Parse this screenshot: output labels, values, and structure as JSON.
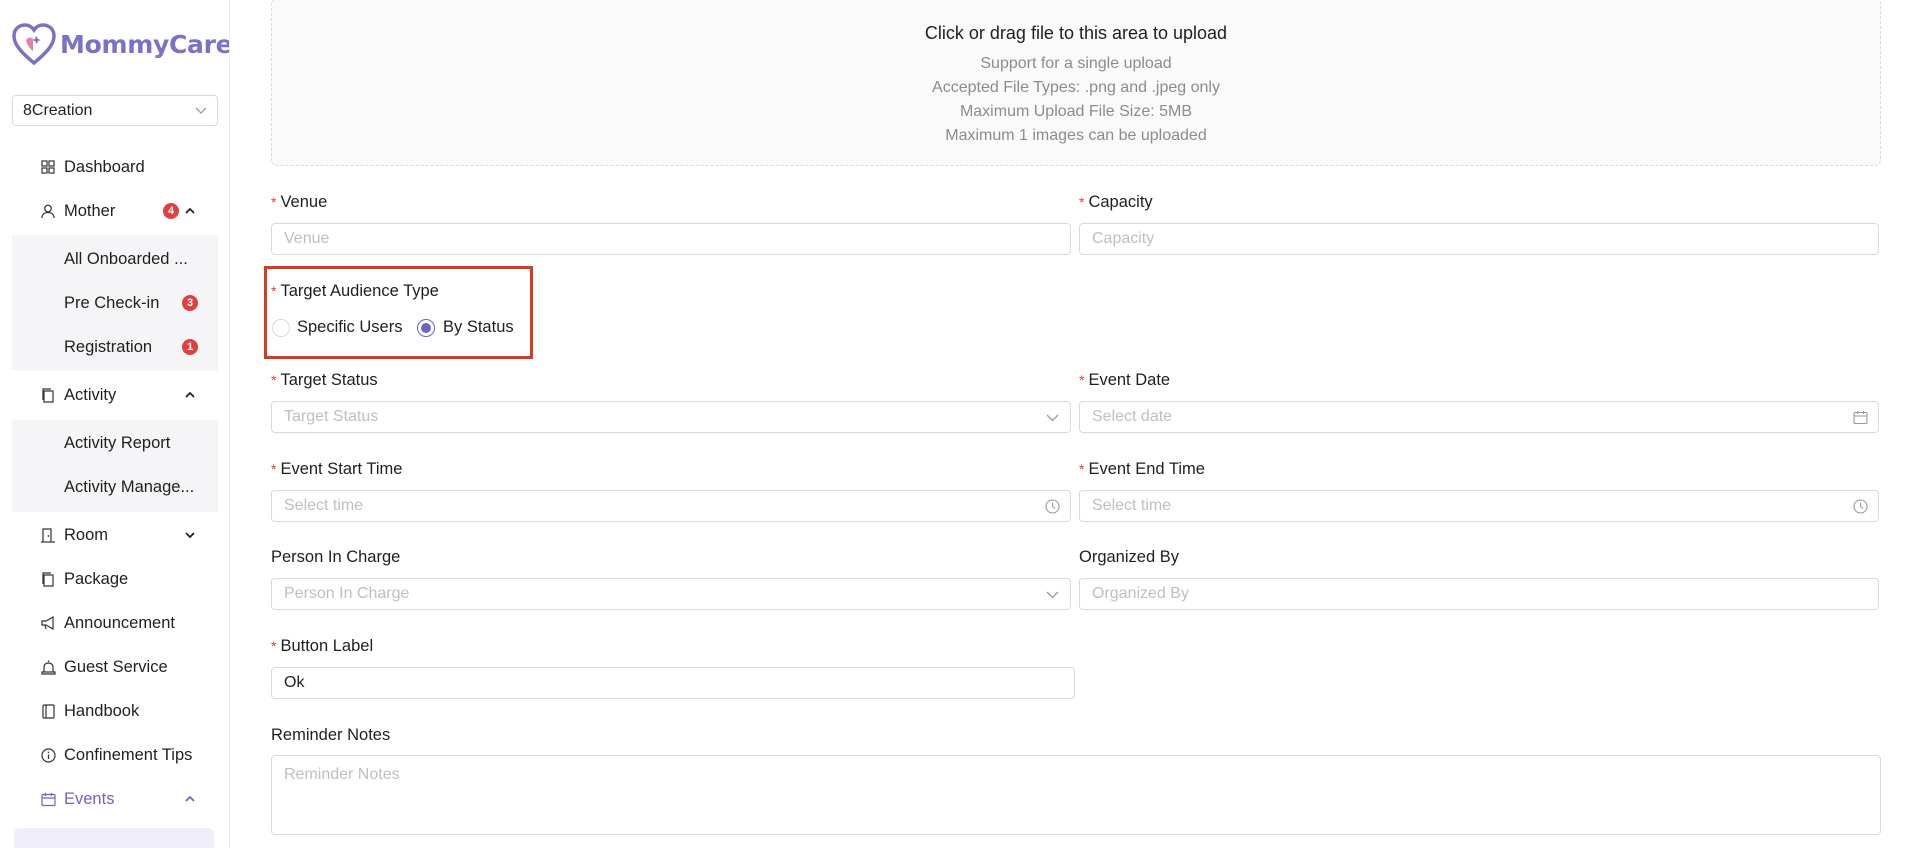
{
  "brand": {
    "name": "MommyCare",
    "plus": "+"
  },
  "company_select": {
    "value": "8Creation"
  },
  "sidebar": {
    "items": [
      {
        "label": "Dashboard"
      },
      {
        "label": "Mother",
        "badge": "4"
      },
      {
        "label": "Activity"
      },
      {
        "label": "Room"
      },
      {
        "label": "Package"
      },
      {
        "label": "Announcement"
      },
      {
        "label": "Guest Service"
      },
      {
        "label": "Handbook"
      },
      {
        "label": "Confinement Tips"
      },
      {
        "label": "Events"
      }
    ],
    "mother_sub": [
      {
        "label": "All Onboarded ..."
      },
      {
        "label": "Pre Check-in",
        "badge": "3"
      },
      {
        "label": "Registration",
        "badge": "1"
      }
    ],
    "activity_sub": [
      {
        "label": "Activity Report"
      },
      {
        "label": "Activity Manage..."
      }
    ]
  },
  "upload": {
    "title": "Click or drag file to this area to upload",
    "lines": [
      "Support for a single upload",
      "Accepted File Types: .png and .jpeg only",
      "Maximum Upload File Size: 5MB",
      "Maximum 1 images can be uploaded"
    ]
  },
  "form": {
    "venue": {
      "label": "Venue",
      "placeholder": "Venue",
      "required": "*"
    },
    "capacity": {
      "label": "Capacity",
      "placeholder": "Capacity",
      "required": "*"
    },
    "audience": {
      "label": "Target Audience Type",
      "required": "*",
      "options": [
        "Specific Users",
        "By Status"
      ],
      "selected": "By Status"
    },
    "target_status": {
      "label": "Target Status",
      "placeholder": "Target Status",
      "required": "*"
    },
    "event_date": {
      "label": "Event Date",
      "placeholder": "Select date",
      "required": "*"
    },
    "start_time": {
      "label": "Event Start Time",
      "placeholder": "Select time",
      "required": "*"
    },
    "end_time": {
      "label": "Event End Time",
      "placeholder": "Select time",
      "required": "*"
    },
    "person_in_charge": {
      "label": "Person In Charge",
      "placeholder": "Person In Charge"
    },
    "organized_by": {
      "label": "Organized By",
      "placeholder": "Organized By"
    },
    "button_label": {
      "label": "Button Label",
      "value": "Ok",
      "required": "*"
    },
    "reminder_notes": {
      "label": "Reminder Notes",
      "placeholder": "Reminder Notes"
    }
  },
  "colors": {
    "accent": "#6d64c2",
    "badge": "#e0403f",
    "highlight": "#d63a22",
    "required": "#e0403f"
  }
}
